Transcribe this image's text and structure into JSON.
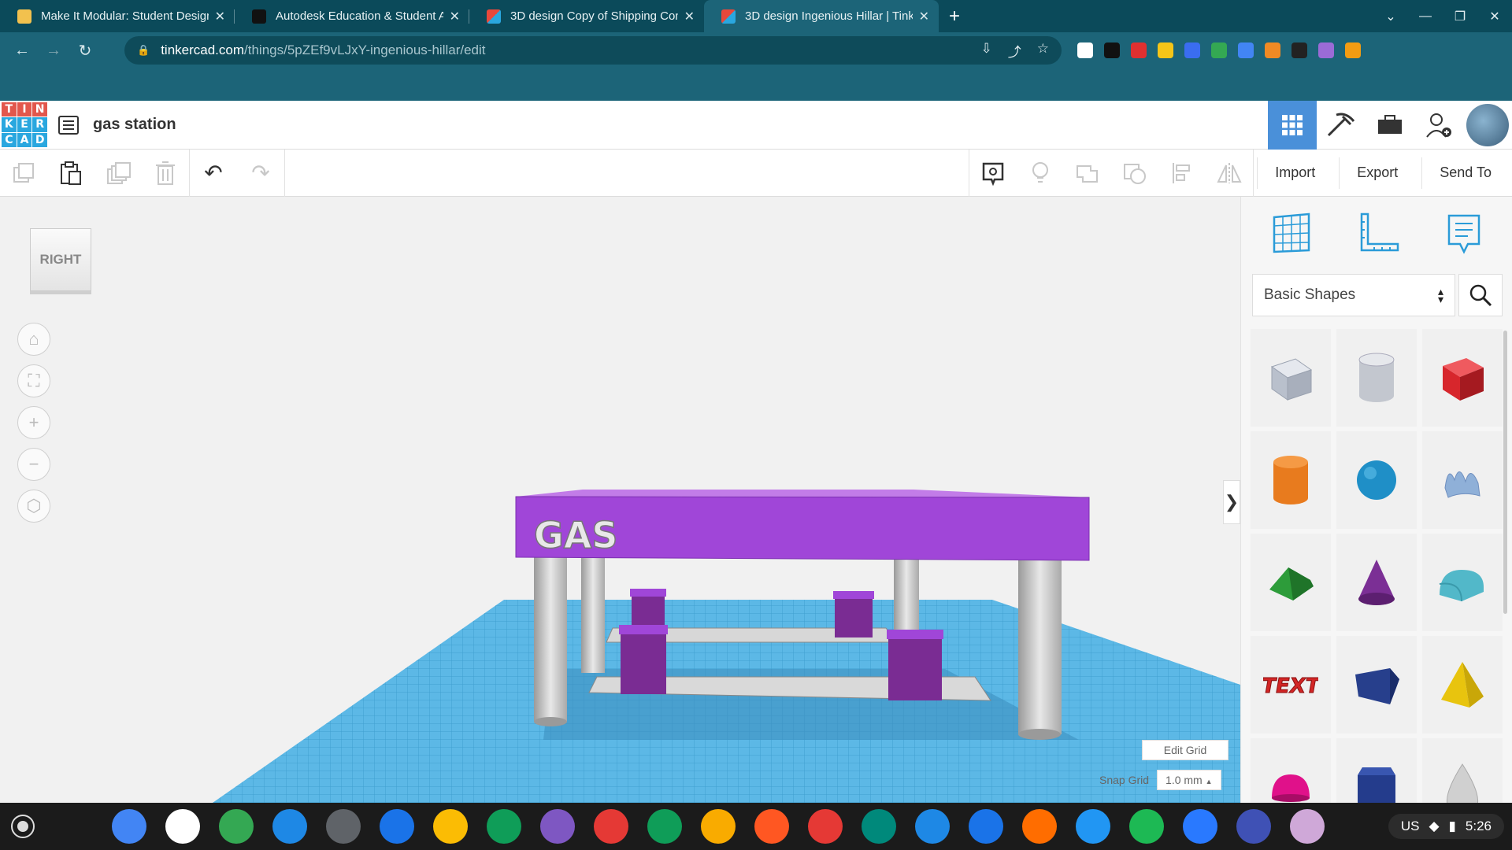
{
  "browser": {
    "tabs": [
      {
        "title": "Make It Modular: Student Design",
        "favicon_color": "#f2c14e",
        "active": false
      },
      {
        "title": "Autodesk Education & Student A",
        "favicon_color": "#111111",
        "active": false
      },
      {
        "title": "3D design Copy of Shipping Cont",
        "favicon_color": "#e8483b",
        "active": false
      },
      {
        "title": "3D design Ingenious Hillar | Tinke",
        "favicon_color": "#e8483b",
        "active": true
      }
    ],
    "new_tab_glyph": "+",
    "url_host": "tinkercad.com",
    "url_path": "/things/5pZEf9vLJxY-ingenious-hillar/edit",
    "extension_colors": [
      "#ffffff",
      "#111111",
      "#e03030",
      "#f5c518",
      "#3a6df0",
      "#34a853",
      "#4285f4",
      "#f08a24",
      "#222222",
      "#9b6bd6",
      "#f39c12"
    ]
  },
  "app": {
    "logo_letters": [
      "T",
      "I",
      "N",
      "K",
      "E",
      "R",
      "C",
      "A",
      "D"
    ],
    "logo_colors": [
      "#e2574c",
      "#e2574c",
      "#e2574c",
      "#2aa7df",
      "#2aa7df",
      "#2aa7df",
      "#2aa7df",
      "#2aa7df",
      "#2aa7df"
    ],
    "project_title": "gas station",
    "accent": "#4a90d9"
  },
  "toolbar": {
    "import_label": "Import",
    "export_label": "Export",
    "send_label": "Send To"
  },
  "viewcube": {
    "face_label": "RIGHT"
  },
  "scene": {
    "sign_text": "GAS",
    "canopy_color": "#a046d8",
    "pump_color": "#7a2c93",
    "grid_color": "#5cb8e6"
  },
  "workplane": {
    "edit_grid_label": "Edit Grid",
    "snap_label": "Snap Grid",
    "snap_value": "1.0 mm",
    "snap_caret": "▲"
  },
  "panel": {
    "category": "Basic Shapes",
    "shapes": [
      {
        "name": "Box Hole",
        "color": "#b9c0cc"
      },
      {
        "name": "Cylinder Hole",
        "color": "#c3c7cf"
      },
      {
        "name": "Box",
        "color": "#d7262c"
      },
      {
        "name": "Cylinder",
        "color": "#e87b1e"
      },
      {
        "name": "Sphere",
        "color": "#1f8fc7"
      },
      {
        "name": "Scribble",
        "color": "#8fb0d8"
      },
      {
        "name": "Roof",
        "color": "#2d9c3a"
      },
      {
        "name": "Cone",
        "color": "#7b2f95"
      },
      {
        "name": "Round Roof",
        "color": "#52b8c9"
      },
      {
        "name": "Text",
        "color": "#d22525"
      },
      {
        "name": "Wedge",
        "color": "#273f8c"
      },
      {
        "name": "Pyramid",
        "color": "#e8c40e"
      },
      {
        "name": "Half Sphere",
        "color": "#e0118a"
      },
      {
        "name": "Polygon",
        "color": "#243c8c"
      },
      {
        "name": "Paraboloid",
        "color": "#d0d0d0"
      }
    ]
  },
  "taskbar": {
    "app_colors": [
      "#4285f4",
      "#ffffff",
      "#34a853",
      "#1e88e5",
      "#5f6368",
      "#1a73e8",
      "#fbbc04",
      "#0f9d58",
      "#7e57c2",
      "#e53935",
      "#0f9d58",
      "#f9ab00",
      "#ff5722",
      "#e53935",
      "#00897b",
      "#1e88e5",
      "#1a73e8",
      "#ff6d00",
      "#2196f3",
      "#1db954",
      "#2979ff",
      "#3f51b5",
      "#cfa8d8"
    ],
    "locale": "US",
    "time": "5:26"
  }
}
